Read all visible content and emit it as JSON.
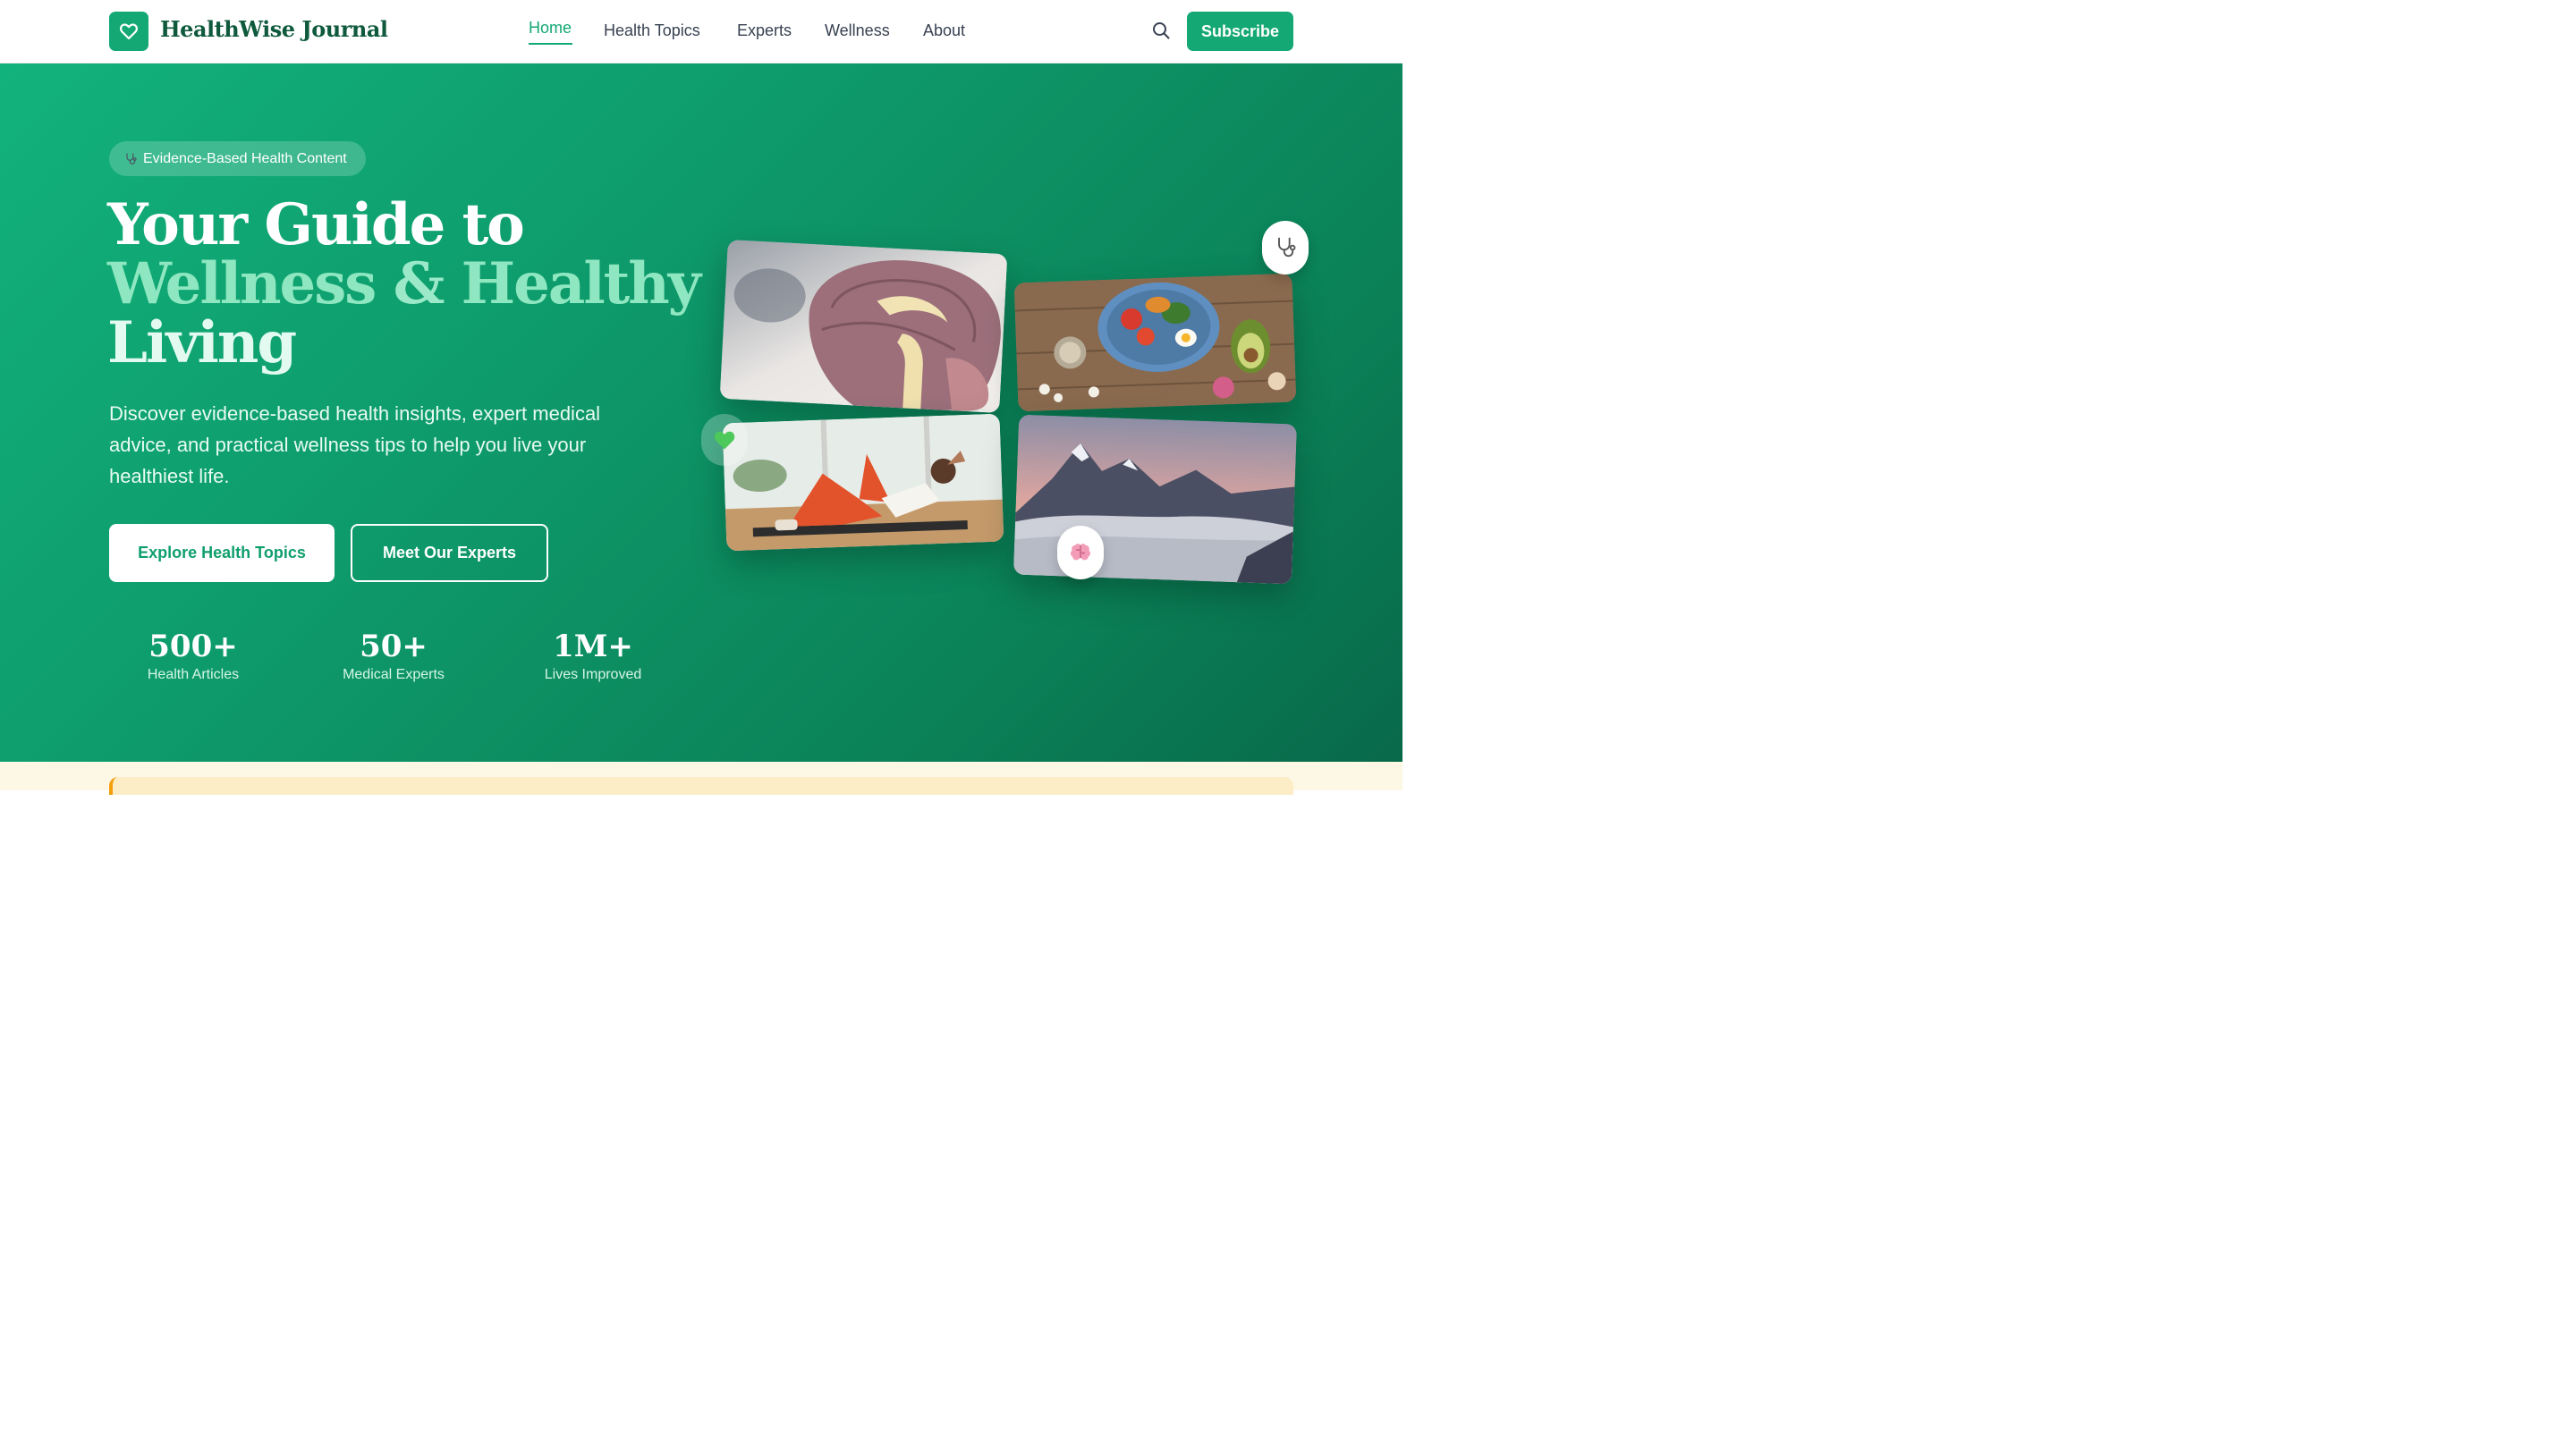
{
  "header": {
    "brand": "HealthWise Journal",
    "nav": [
      "Home",
      "Health Topics",
      "Experts",
      "Wellness",
      "About"
    ],
    "active_nav": "Home",
    "subscribe_label": "Subscribe"
  },
  "hero": {
    "pill_icon": "stethoscope-icon",
    "pill_text": "Evidence-Based Health Content",
    "title_line1": "Your Guide to",
    "title_line2_a": "Wellness",
    "title_line2_amp": "&",
    "title_line2_b": "Healthy",
    "title_line3": "Living",
    "lead": "Discover evidence-based health insights, expert medical advice, and practical wellness tips to help you live your healthiest life.",
    "primary_button": "Explore Health Topics",
    "secondary_button": "Meet Our Experts",
    "stats": [
      {
        "value": "500+",
        "label": "Health Articles"
      },
      {
        "value": "50+",
        "label": "Medical Experts"
      },
      {
        "value": "1M+",
        "label": "Lives Improved"
      }
    ]
  },
  "colors": {
    "brand": "#14a874",
    "brand_dark": "#0f5a3c",
    "hero_start": "#12b27c",
    "hero_end": "#08694a",
    "accent_light": "#8fe7c1",
    "strip_accent": "#f59e0b"
  },
  "icons": [
    "heart-icon",
    "search-icon",
    "stethoscope-icon",
    "green-heart-icon",
    "brain-icon"
  ]
}
